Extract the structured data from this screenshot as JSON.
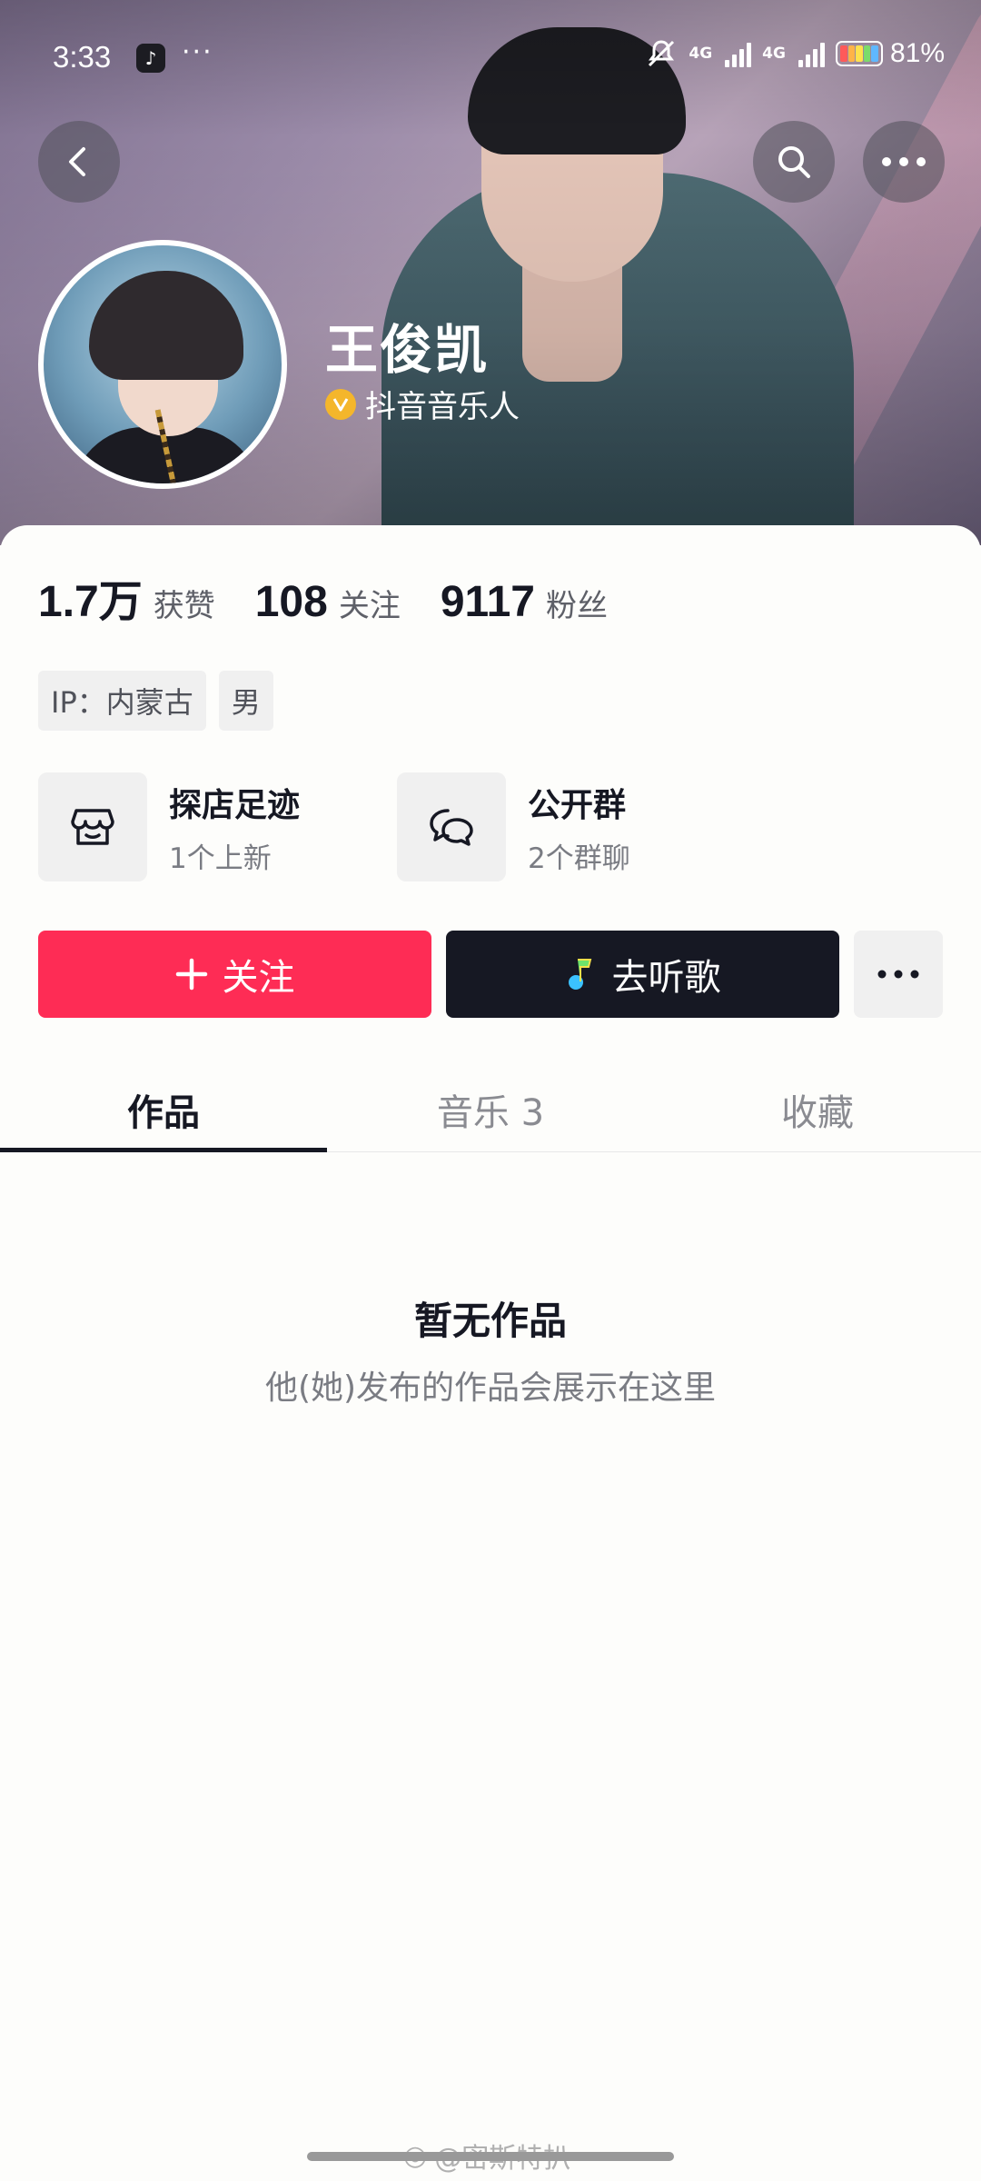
{
  "status_bar": {
    "time": "3:33",
    "app_icon": "tiktok-icon",
    "more": "···",
    "network_1": "4G",
    "network_2": "4G",
    "battery": "81%"
  },
  "profile": {
    "name": "王俊凯",
    "verification": "抖音音乐人",
    "verification_badge": "V"
  },
  "stats": [
    {
      "value": "1.7万",
      "label": "获赞"
    },
    {
      "value": "108",
      "label": "关注"
    },
    {
      "value": "9117",
      "label": "粉丝"
    }
  ],
  "tags": [
    "IP：内蒙古",
    "男"
  ],
  "features": [
    {
      "icon": "store-icon",
      "title": "探店足迹",
      "subtitle": "1个上新"
    },
    {
      "icon": "chat-bubbles-icon",
      "title": "公开群",
      "subtitle": "2个群聊"
    }
  ],
  "actions": {
    "follow": "关注",
    "listen": "去听歌"
  },
  "tabs": [
    {
      "label": "作品",
      "active": true
    },
    {
      "label": "音乐 3",
      "active": false
    },
    {
      "label": "收藏",
      "active": false
    }
  ],
  "empty_state": {
    "title": "暂无作品",
    "subtitle": "他(她)发布的作品会展示在这里"
  },
  "watermark": "@密斯特扒",
  "colors": {
    "follow": "#fe2c55",
    "dark": "#161823",
    "verify_badge": "#f4b62b"
  }
}
